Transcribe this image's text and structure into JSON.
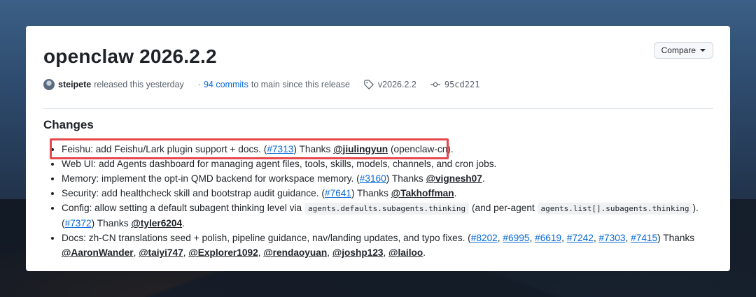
{
  "release": {
    "title": "openclaw 2026.2.2",
    "compare_label": "Compare",
    "author": "steipete",
    "released_text": "released this yesterday",
    "dot": "·",
    "commits_link": "94 commits",
    "commits_suffix": "to main since this release",
    "tag": "v2026.2.2",
    "commit": "95cd221"
  },
  "changes": {
    "heading": "Changes",
    "items": [
      {
        "t1": "Feishu: add Feishu/Lark plugin support + docs. (",
        "link": "#7313",
        "t2": ") Thanks ",
        "mention": "@jiulingyun",
        "t3": " (openclaw-cn)."
      },
      {
        "t1": "Web UI: add Agents dashboard for managing agent files, tools, skills, models, channels, and cron jobs."
      },
      {
        "t1": "Memory: implement the opt-in QMD backend for workspace memory. (",
        "link": "#3160",
        "t2": ") Thanks ",
        "mention": "@vignesh07",
        "t3": "."
      },
      {
        "t1": "Security: add healthcheck skill and bootstrap audit guidance. (",
        "link": "#7641",
        "t2": ") Thanks ",
        "mention": "@Takhoffman",
        "t3": "."
      },
      {
        "t1": "Config: allow setting a default subagent thinking level via ",
        "code1": "agents.defaults.subagents.thinking",
        "t2": " (and per-agent ",
        "code2": "agents.list[].subagents.thinking",
        "t3": ").",
        "t4": "(",
        "link": "#7372",
        "t5": ") Thanks ",
        "mention": "@tyler6204",
        "t6": "."
      },
      {
        "t1": "Docs: zh-CN translations seed + polish, pipeline guidance, nav/landing updates, and typo fixes. (",
        "links": [
          "#8202",
          "#6995",
          "#6619",
          "#7242",
          "#7303",
          "#7415"
        ],
        "sep": ", ",
        "t2": ") Thanks",
        "mentions": [
          "@AaronWander",
          "@taiyi747",
          "@Explorer1092",
          "@rendaoyuan",
          "@joshp123",
          "@lailoo"
        ],
        "t3": "."
      }
    ]
  },
  "colors": {
    "link": "#0969da",
    "text": "#1f2328",
    "muted": "#57606a",
    "highlight_border": "#e5484d"
  },
  "icons": {
    "tag": "tag-icon",
    "commit": "git-commit-icon",
    "caret": "caret-down-icon",
    "avatar": "avatar"
  }
}
